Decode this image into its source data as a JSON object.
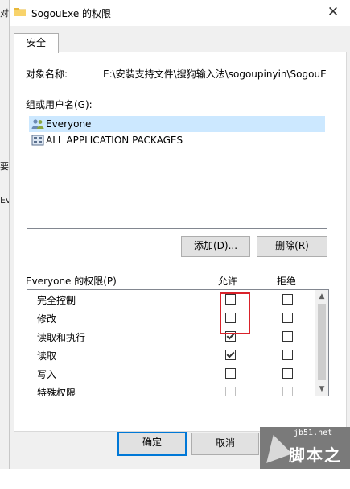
{
  "background_window": {
    "fragments": [
      "对",
      "要",
      "Ev"
    ]
  },
  "window": {
    "title": "SogouExe 的权限",
    "close_glyph": "✕"
  },
  "tabs": [
    {
      "label": "安全"
    }
  ],
  "object": {
    "label": "对象名称:",
    "path": "E:\\安装支持文件\\搜狗输入法\\sogoupinyin\\SogouE"
  },
  "groups": {
    "label": "组或用户名(G):",
    "users": [
      {
        "name": "Everyone",
        "selected": true,
        "icon": "users-icon"
      },
      {
        "name": "ALL APPLICATION PACKAGES",
        "selected": false,
        "icon": "packages-icon"
      }
    ]
  },
  "buttons": {
    "add": "添加(D)...",
    "remove": "删除(R)"
  },
  "permissions": {
    "title": "Everyone 的权限(P)",
    "allow_header": "允许",
    "deny_header": "拒绝",
    "rows": [
      {
        "name": "完全控制",
        "allow": false,
        "deny": false
      },
      {
        "name": "修改",
        "allow": false,
        "deny": false
      },
      {
        "name": "读取和执行",
        "allow": true,
        "deny": false
      },
      {
        "name": "读取",
        "allow": true,
        "deny": false
      },
      {
        "name": "写入",
        "allow": false,
        "deny": false
      },
      {
        "name": "特殊权限",
        "allow": false,
        "deny": false
      }
    ]
  },
  "footer": {
    "ok": "确定",
    "cancel": "取消"
  },
  "watermark": {
    "line1": "jb51.net",
    "line2": "脚本之家"
  },
  "colors": {
    "selection": "#cce8ff",
    "highlight_box": "#d9222a",
    "default_button_border": "#0078d7"
  }
}
